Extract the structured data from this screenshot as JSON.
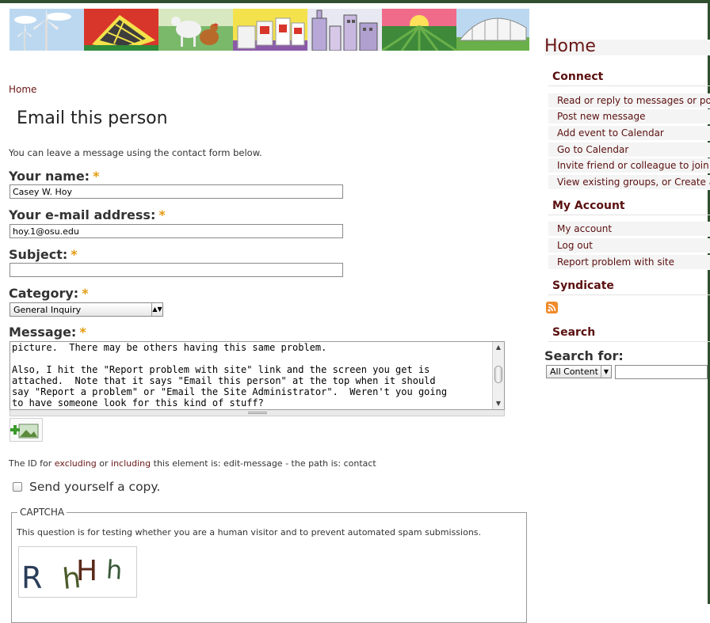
{
  "breadcrumb": "Home",
  "page_title": "Email this person",
  "intro": "You can leave a message using the contact form below.",
  "required_mark": "*",
  "form": {
    "name_label": "Your name:",
    "name_value": "Casey W. Hoy",
    "email_label": "Your e-mail address:",
    "email_value": "hoy.1@osu.edu",
    "subject_label": "Subject:",
    "subject_value": "",
    "category_label": "Category:",
    "category_value": "General Inquiry",
    "message_label": "Message:",
    "message_text": "picture.  There may be others having this same problem.\n\nAlso, I hit the \"Report problem with site\" link and the screen you get is\nattached.  Note that it says \"Email this person\" at the top when it should\nsay \"Report a problem\" or \"Email the Site Administrator\".  Weren't you going\nto have someone look for this kind of stuff?",
    "id_prefix": "The ID for",
    "id_excluding": "excluding",
    "id_or": "or",
    "id_including": "including",
    "id_suffix": "this element is: edit-message - the path is: contact",
    "copy_label": "Send yourself a copy.",
    "captcha_legend": "CAPTCHA",
    "captcha_desc": "This question is for testing whether you are a human visitor and to prevent automated spam submissions.",
    "captcha_chars": [
      "R",
      "h",
      "H",
      "h"
    ]
  },
  "sidebar": {
    "title": "Home",
    "connect_heading": "Connect",
    "connect_links": [
      "Read or reply to messages or posts",
      "Post new message",
      "Add event to Calendar",
      "Go to Calendar",
      "Invite friend or colleague to join"
    ],
    "groups_link_plain": "View existing groups, or",
    "groups_link_create": "Create a group",
    "account_heading": "My Account",
    "account_links": [
      "My account",
      "Log out",
      "Report problem with site"
    ],
    "syndicate_heading": "Syndicate",
    "search_heading": "Search",
    "search_label": "Search for:",
    "search_scope": "All Content",
    "search_value": ""
  },
  "colors": {
    "link": "#6a1616",
    "required": "#e49b0f",
    "frame": "#2f4f2f"
  }
}
